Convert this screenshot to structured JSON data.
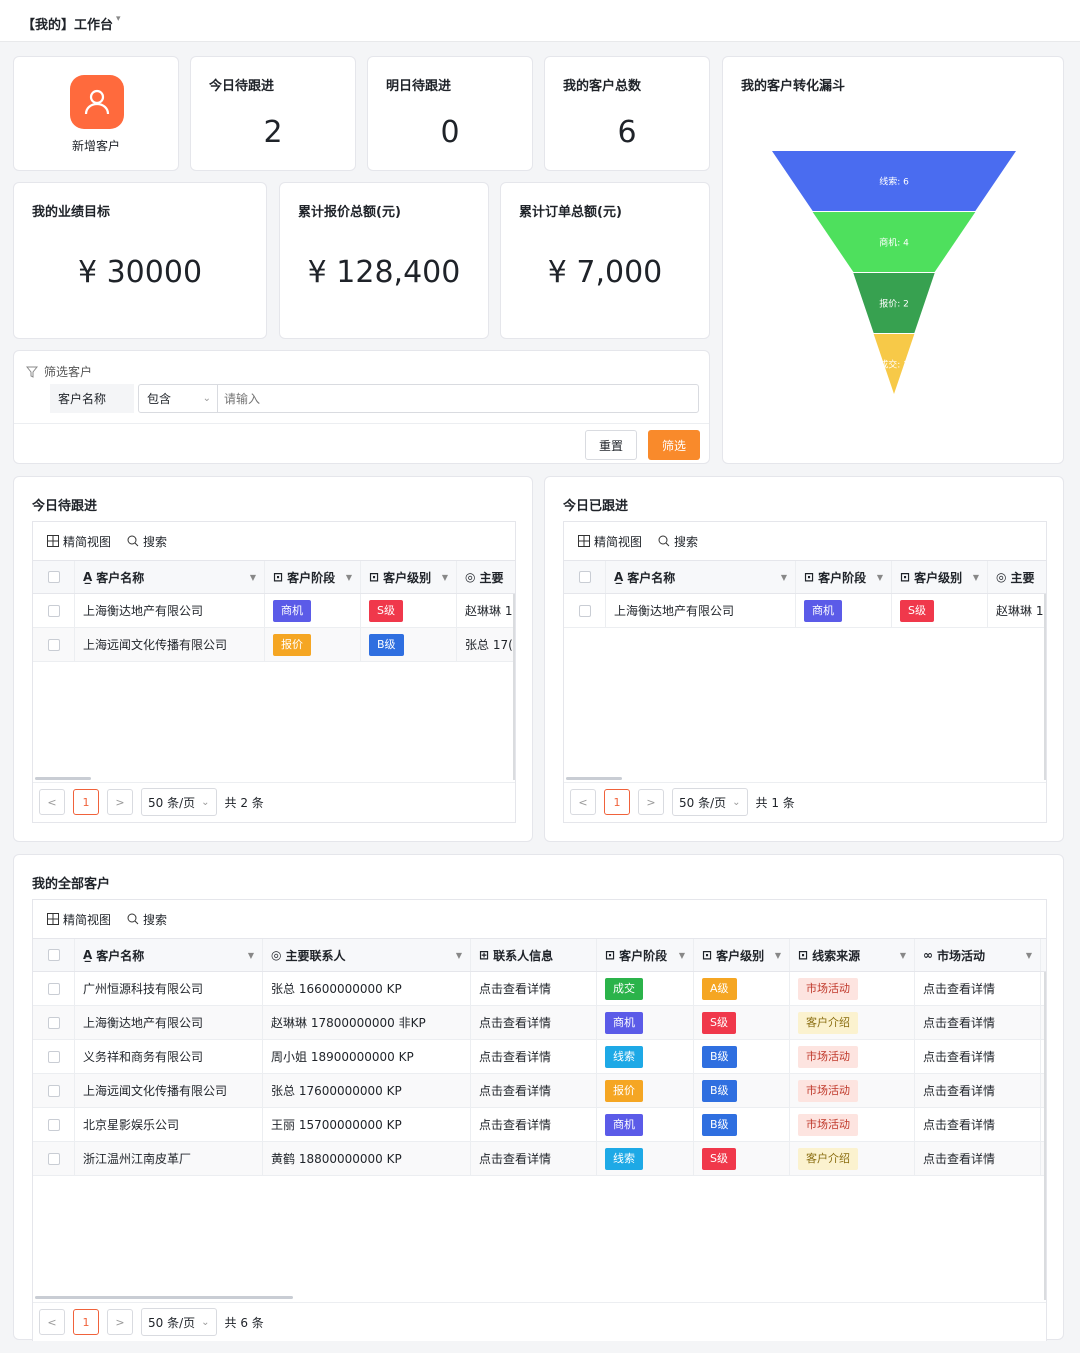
{
  "header": {
    "title": "【我的】工作台",
    "caret": "▾"
  },
  "new_customer": {
    "label": "新增客户"
  },
  "stats": [
    {
      "label": "今日待跟进",
      "value": "2"
    },
    {
      "label": "明日待跟进",
      "value": "0"
    },
    {
      "label": "我的客户总数",
      "value": "6"
    }
  ],
  "money": [
    {
      "label": "我的业绩目标",
      "value": "¥ 30000"
    },
    {
      "label": "累计报价总额(元)",
      "value": "¥ 128,400"
    },
    {
      "label": "累计订单总额(元)",
      "value": "¥ 7,000"
    }
  ],
  "funnel": {
    "title": "我的客户转化漏斗",
    "stages": [
      {
        "label": "线索: 6",
        "value": 6,
        "color": "#4a6cf0"
      },
      {
        "label": "商机: 4",
        "value": 4,
        "color": "#4ee05d"
      },
      {
        "label": "报价: 2",
        "value": 2,
        "color": "#37a150"
      },
      {
        "label": "成交: 1",
        "value": 1,
        "color": "#f7c948"
      }
    ]
  },
  "filter": {
    "title": "筛选客户",
    "field": "客户名称",
    "operator": "包含",
    "placeholder": "请输入",
    "reset": "重置",
    "submit": "筛选"
  },
  "toolbar": {
    "view": "精简视图",
    "search": "搜索"
  },
  "today_pending": {
    "title": "今日待跟进",
    "columns": [
      "客户名称",
      "客户阶段",
      "客户级别",
      "主要"
    ],
    "rows": [
      {
        "name": "上海衡达地产有限公司",
        "stage": "商机",
        "level": "S级",
        "contact": "赵琳琳 1"
      },
      {
        "name": "上海远闻文化传播有限公司",
        "stage": "报价",
        "level": "B级",
        "contact": "张总 17("
      }
    ],
    "page": "1",
    "page_size": "50 条/页",
    "total": "共 2 条"
  },
  "today_done": {
    "title": "今日已跟进",
    "columns": [
      "客户名称",
      "客户阶段",
      "客户级别",
      "主要"
    ],
    "rows": [
      {
        "name": "上海衡达地产有限公司",
        "stage": "商机",
        "level": "S级",
        "contact": "赵琳琳 1"
      }
    ],
    "page": "1",
    "page_size": "50 条/页",
    "total": "共 1 条"
  },
  "all_customers": {
    "title": "我的全部客户",
    "columns": [
      "客户名称",
      "主要联系人",
      "联系人信息",
      "客户阶段",
      "客户级别",
      "线索来源",
      "市场活动"
    ],
    "rows": [
      {
        "name": "广州恒源科技有限公司",
        "contact": "张总 16600000000 KP",
        "info": "点击查看详情",
        "stage": "成交",
        "level": "A级",
        "source": "市场活动",
        "activity": "点击查看详情"
      },
      {
        "name": "上海衡达地产有限公司",
        "contact": "赵琳琳 17800000000 非KP",
        "info": "点击查看详情",
        "stage": "商机",
        "level": "S级",
        "source": "客户介绍",
        "activity": "点击查看详情"
      },
      {
        "name": "义务祥和商务有限公司",
        "contact": "周小姐 18900000000 KP",
        "info": "点击查看详情",
        "stage": "线索",
        "level": "B级",
        "source": "市场活动",
        "activity": "点击查看详情"
      },
      {
        "name": "上海远闻文化传播有限公司",
        "contact": "张总 17600000000 KP",
        "info": "点击查看详情",
        "stage": "报价",
        "level": "B级",
        "source": "市场活动",
        "activity": "点击查看详情"
      },
      {
        "name": "北京星影娱乐公司",
        "contact": "王丽 15700000000 KP",
        "info": "点击查看详情",
        "stage": "商机",
        "level": "B级",
        "source": "市场活动",
        "activity": "点击查看详情"
      },
      {
        "name": "浙江温州江南皮革厂",
        "contact": "黄鹤 18800000000 KP",
        "info": "点击查看详情",
        "stage": "线索",
        "level": "S级",
        "source": "客户介绍",
        "activity": "点击查看详情"
      }
    ],
    "page": "1",
    "page_size": "50 条/页",
    "total": "共 6 条"
  },
  "colors": {
    "stage": {
      "成交": "#2bb34a",
      "商机": "#5b5be8",
      "线索": "#1ea9e6",
      "报价": "#f5a623"
    },
    "level": {
      "A级": "#f5a623",
      "S级": "#f0384b",
      "B级": "#2f6fe0"
    },
    "accent": "#f98a2b"
  }
}
